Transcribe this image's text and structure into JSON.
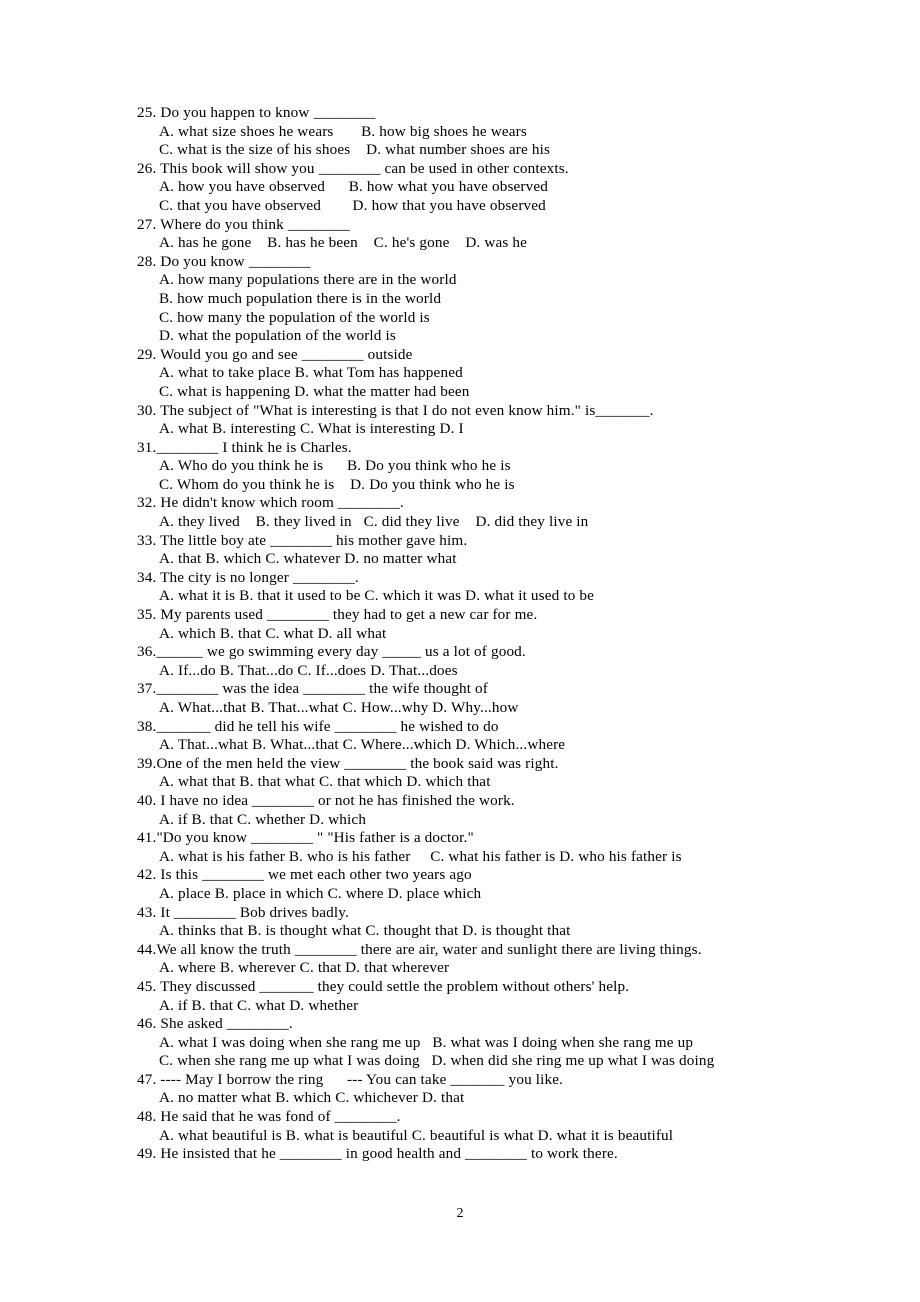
{
  "document": {
    "page_number": "2",
    "language": "en",
    "kind": "multiple-choice-grammar-worksheet"
  },
  "lines": [
    {
      "type": "question",
      "text": "25. Do you happen to know ________"
    },
    {
      "type": "options",
      "text": "A. what size shoes he wears       B. how big shoes he wears"
    },
    {
      "type": "options",
      "text": "C. what is the size of his shoes    D. what number shoes are his"
    },
    {
      "type": "question",
      "text": "26. This book will show you ________ can be used in other contexts."
    },
    {
      "type": "options",
      "text": "A. how you have observed      B. how what you have observed"
    },
    {
      "type": "options",
      "text": "C. that you have observed        D. how that you have observed"
    },
    {
      "type": "question",
      "text": "27. Where do you think ________"
    },
    {
      "type": "options",
      "text": "A. has he gone    B. has he been    C. he's gone    D. was he"
    },
    {
      "type": "question",
      "text": "28. Do you know ________"
    },
    {
      "type": "options",
      "text": "A. how many populations there are in the world"
    },
    {
      "type": "options",
      "text": "B. how much population there is in the world"
    },
    {
      "type": "options",
      "text": "C. how many the population of the world is"
    },
    {
      "type": "options",
      "text": "D. what the population of the world is"
    },
    {
      "type": "question",
      "text": "29. Would you go and see ________ outside"
    },
    {
      "type": "options",
      "text": "A. what to take place B. what Tom has happened"
    },
    {
      "type": "options",
      "text": "C. what is happening D. what the matter had been"
    },
    {
      "type": "question",
      "text": "30. The subject of \"What is interesting is that I do not even know him.\" is_______."
    },
    {
      "type": "options",
      "text": "A. what B. interesting C. What is interesting D. I"
    },
    {
      "type": "question",
      "text": "31.________ I think he is Charles."
    },
    {
      "type": "options",
      "text": "A. Who do you think he is      B. Do you think who he is"
    },
    {
      "type": "options",
      "text": "C. Whom do you think he is    D. Do you think who he is"
    },
    {
      "type": "question",
      "text": "32. He didn't know which room ________."
    },
    {
      "type": "options",
      "text": "A. they lived    B. they lived in   C. did they live    D. did they live in"
    },
    {
      "type": "question",
      "text": "33. The little boy ate ________ his mother gave him."
    },
    {
      "type": "options",
      "text": "A. that B. which C. whatever D. no matter what"
    },
    {
      "type": "question",
      "text": "34. The city is no longer ________."
    },
    {
      "type": "options",
      "text": "A. what it is B. that it used to be C. which it was D. what it used to be"
    },
    {
      "type": "question",
      "text": "35. My parents used ________ they had to get a new car for me."
    },
    {
      "type": "options",
      "text": "A. which B. that C. what D. all what"
    },
    {
      "type": "question",
      "text": "36.______ we go swimming every day _____ us a lot of good."
    },
    {
      "type": "options",
      "text": "A. If...do B. That...do C. If...does D. That...does"
    },
    {
      "type": "question",
      "text": "37.________ was the idea ________ the wife thought of"
    },
    {
      "type": "options",
      "text": "A. What...that B. That...what C. How...why D. Why...how"
    },
    {
      "type": "question",
      "text": "38._______ did he tell his wife ________ he wished to do"
    },
    {
      "type": "options",
      "text": "A. That...what B. What...that C. Where...which D. Which...where"
    },
    {
      "type": "question",
      "text": "39.One of the men held the view ________ the book said was right."
    },
    {
      "type": "options",
      "text": "A. what that B. that what C. that which D. which that"
    },
    {
      "type": "question",
      "text": "40. I have no idea ________ or not he has finished the work."
    },
    {
      "type": "options",
      "text": "A. if B. that C. whether D. which"
    },
    {
      "type": "question",
      "text": "41.\"Do you know ________ \" \"His father is a doctor.\""
    },
    {
      "type": "options",
      "text": "A. what is his father B. who is his father     C. what his father is D. who his father is"
    },
    {
      "type": "question",
      "text": "42. Is this ________ we met each other two years ago"
    },
    {
      "type": "options",
      "text": "A. place B. place in which C. where D. place which"
    },
    {
      "type": "question",
      "text": "43. It ________ Bob drives badly."
    },
    {
      "type": "options",
      "text": "A. thinks that B. is thought what C. thought that D. is thought that"
    },
    {
      "type": "question",
      "text": "44.We all know the truth ________ there are air, water and sunlight there are living things."
    },
    {
      "type": "options",
      "text": "A. where B. wherever C. that D. that wherever"
    },
    {
      "type": "question",
      "text": "45. They discussed _______ they could settle the problem without others' help."
    },
    {
      "type": "options",
      "text": "A. if B. that C. what D. whether"
    },
    {
      "type": "question",
      "text": "46. She asked ________."
    },
    {
      "type": "options",
      "text": "A. what I was doing when she rang me up   B. what was I doing when she rang me up"
    },
    {
      "type": "options",
      "text": "C. when she rang me up what I was doing   D. when did she ring me up what I was doing"
    },
    {
      "type": "question",
      "text": "47. ---- May I borrow the ring      --- You can take _______ you like."
    },
    {
      "type": "options",
      "text": "A. no matter what B. which C. whichever D. that"
    },
    {
      "type": "question",
      "text": "48. He said that he was fond of ________."
    },
    {
      "type": "options",
      "text": "A. what beautiful is B. what is beautiful C. beautiful is what D. what it is beautiful"
    },
    {
      "type": "question",
      "text": "49. He insisted that he ________ in good health and ________ to work there."
    }
  ]
}
